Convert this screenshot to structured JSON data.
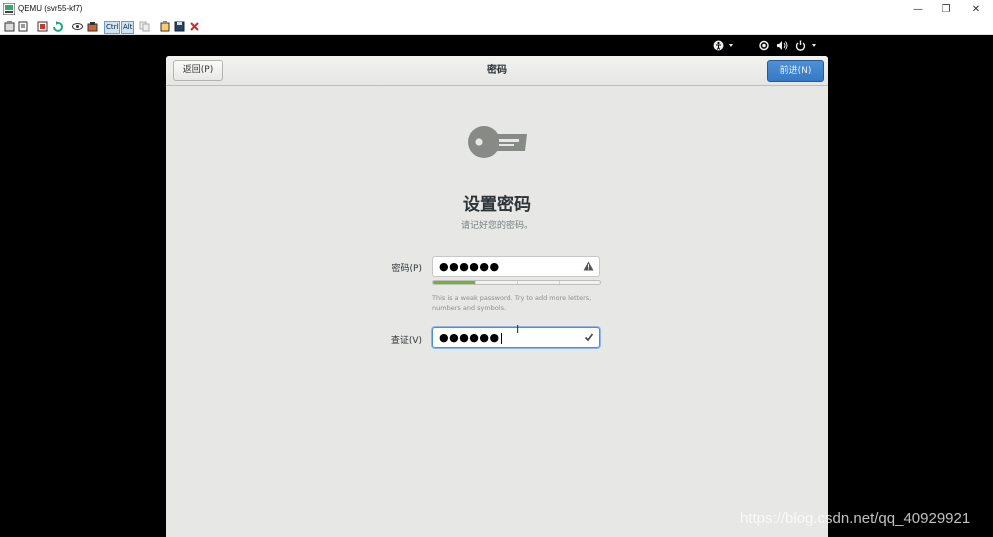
{
  "window": {
    "title": "QEMU (svr55-kf7)",
    "controls": {
      "minimize": "—",
      "restore": "❐",
      "close": "✕"
    }
  },
  "toolbar": {
    "ctrl_label": "Ctrl",
    "alt_label": "Alt"
  },
  "gnome_bar": {
    "icons": [
      "accessibility-icon",
      "network-icon",
      "volume-icon",
      "power-icon"
    ]
  },
  "header": {
    "back_label": "返回(P)",
    "title": "密码",
    "next_label": "前进(N)"
  },
  "main": {
    "heading": "设置密码",
    "subheading": "请记好您的密码。"
  },
  "password": {
    "label": "密码(P)",
    "value": "●●●●●●",
    "strength": 0.25,
    "hint": "This is a weak password. Try to add more letters, numbers and symbols."
  },
  "confirm": {
    "label": "查证(V)",
    "value": "●●●●●●"
  },
  "watermark": "https://blog.csdn.net/qq_40929921",
  "colors": {
    "accent": "#3579c4",
    "strength_weak": "#73b13b",
    "background": "#e7e7e6"
  }
}
